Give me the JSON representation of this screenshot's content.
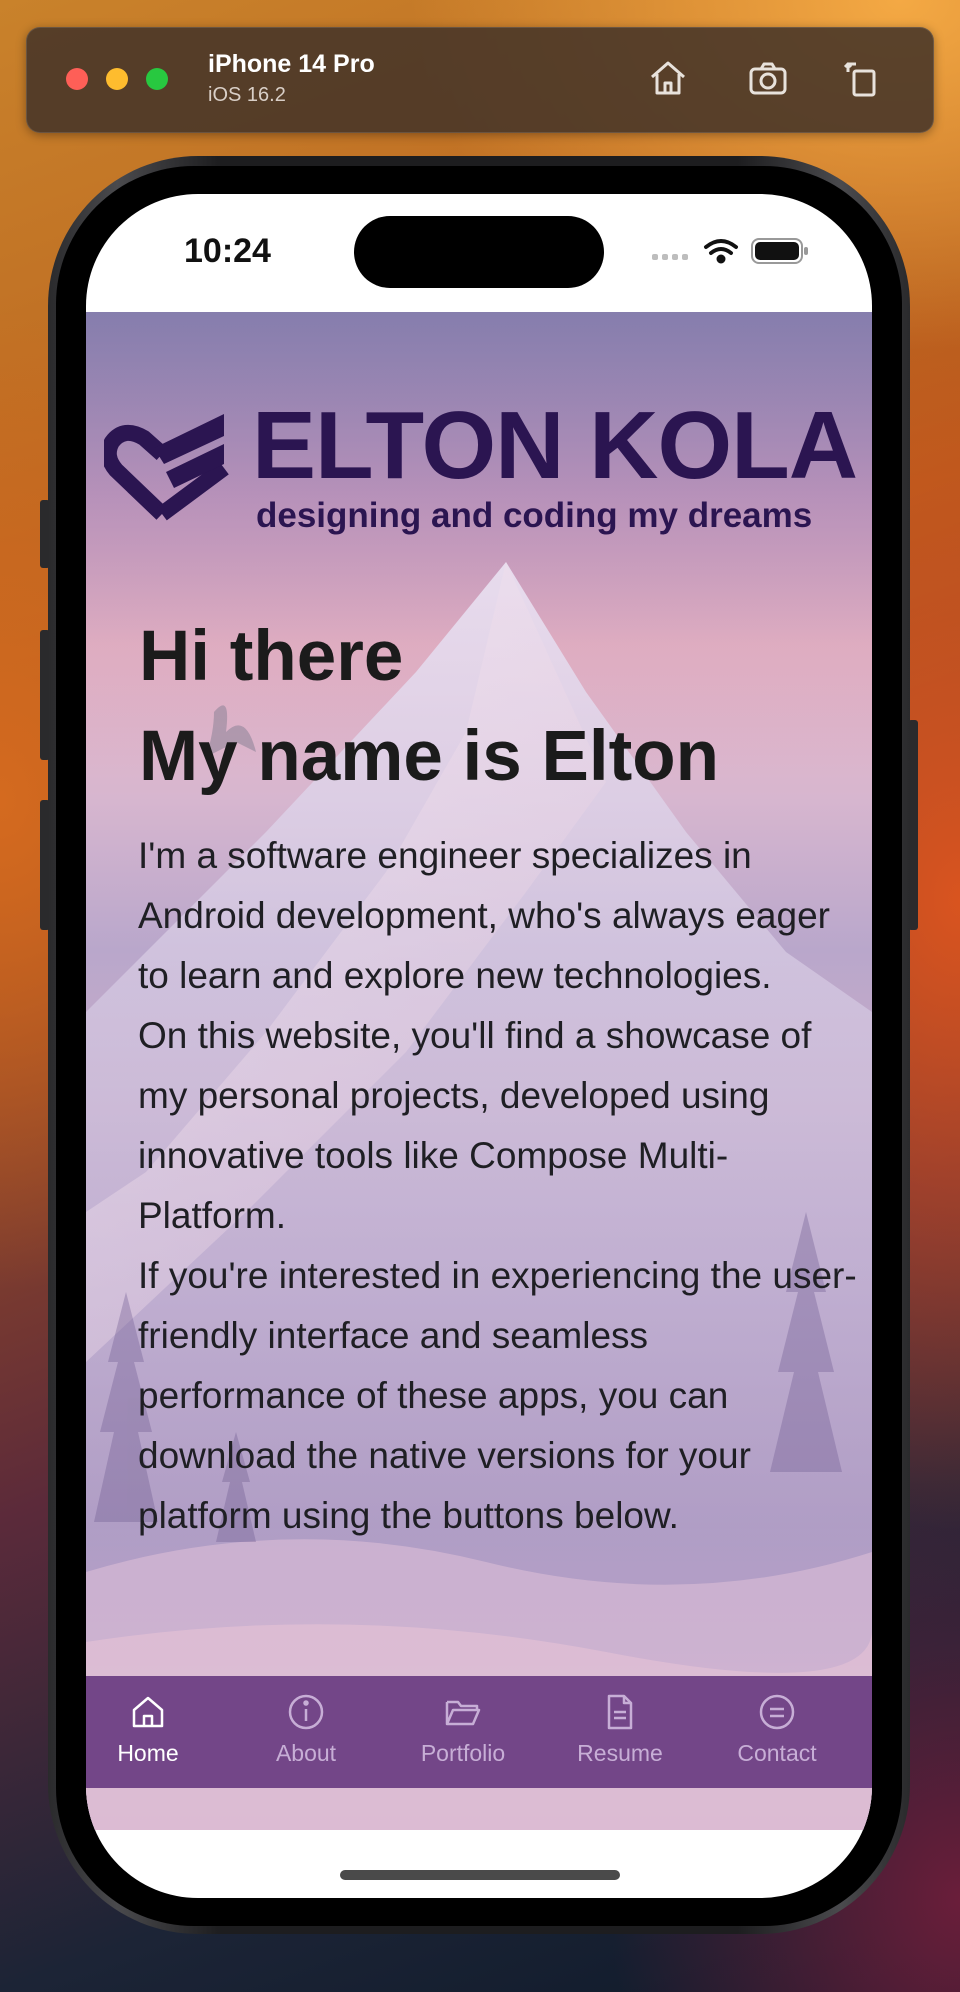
{
  "simulator": {
    "device_name": "iPhone 14 Pro",
    "os_version": "iOS 16.2",
    "buttons": [
      "home-icon",
      "screenshot-icon",
      "rotate-icon"
    ]
  },
  "status_bar": {
    "time": "10:24"
  },
  "site": {
    "logo_title": "ELTON KOLA",
    "logo_subtitle": "designing and coding my dreams",
    "hero_line1": "Hi there",
    "hero_line2": "My name is Elton",
    "paragraphs": [
      "I'm a software engineer specializes in Android development, who's always eager to learn and explore new technologies.",
      "On this website, you'll find a showcase of my personal projects, developed using innovative tools like Compose Multi-Platform.",
      "If you're interested in experiencing the user-friendly interface and seamless performance of these apps, you can download the native versions for your platform using the buttons below."
    ]
  },
  "nav": {
    "active": "Home",
    "items": [
      {
        "label": "Home",
        "icon": "home-icon"
      },
      {
        "label": "About",
        "icon": "info-icon"
      },
      {
        "label": "Portfolio",
        "icon": "folder-icon"
      },
      {
        "label": "Resume",
        "icon": "document-icon"
      },
      {
        "label": "Contact",
        "icon": "chat-icon"
      }
    ]
  },
  "colors": {
    "brand": "#2b1551",
    "nav_background": "#5c2c78",
    "nav_inactive": "#c7aed6",
    "nav_active": "#ffffff"
  }
}
